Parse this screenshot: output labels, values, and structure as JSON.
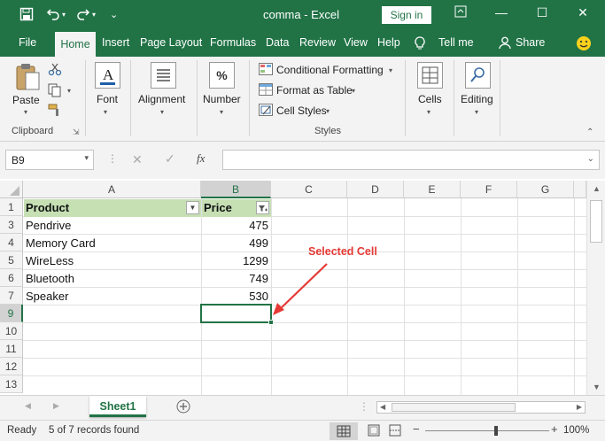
{
  "titlebar": {
    "doc_title": "comma  -  Excel",
    "signin_label": "Sign in"
  },
  "tabs": [
    "File",
    "Home",
    "Insert",
    "Page Layout",
    "Formulas",
    "Data",
    "Review",
    "View",
    "Help"
  ],
  "tell_me": "Tell me",
  "share": "Share",
  "ribbon": {
    "paste": "Paste",
    "clipboard": "Clipboard",
    "font": "Font",
    "alignment": "Alignment",
    "number": "Number",
    "number_icon": "%",
    "conditional_formatting": "Conditional Formatting",
    "format_as_table": "Format as Table",
    "cell_styles": "Cell Styles",
    "styles": "Styles",
    "cells": "Cells",
    "editing": "Editing"
  },
  "formula_bar": {
    "name_box": "B9",
    "fx": "fx",
    "content": ""
  },
  "columns": [
    "A",
    "B",
    "C",
    "D",
    "E",
    "F",
    "G"
  ],
  "rows": [
    "1",
    "3",
    "4",
    "5",
    "6",
    "7",
    "9",
    "10",
    "11",
    "12",
    "13"
  ],
  "table": {
    "headers": [
      "Product",
      "Price"
    ],
    "records": [
      {
        "product": "Pendrive",
        "price": "475"
      },
      {
        "product": "Memory Card",
        "price": "499"
      },
      {
        "product": "WireLess",
        "price": "1299"
      },
      {
        "product": "Bluetooth",
        "price": "749"
      },
      {
        "product": "Speaker",
        "price": "530"
      }
    ]
  },
  "annotation": "Selected Cell",
  "sheets": [
    "Sheet1"
  ],
  "status": {
    "mode": "Ready",
    "filter_info": "5 of 7 records found",
    "zoom": "100%"
  },
  "colors": {
    "brand": "#217346",
    "annotation": "#e53935",
    "header_fill": "#c6e0b4"
  }
}
